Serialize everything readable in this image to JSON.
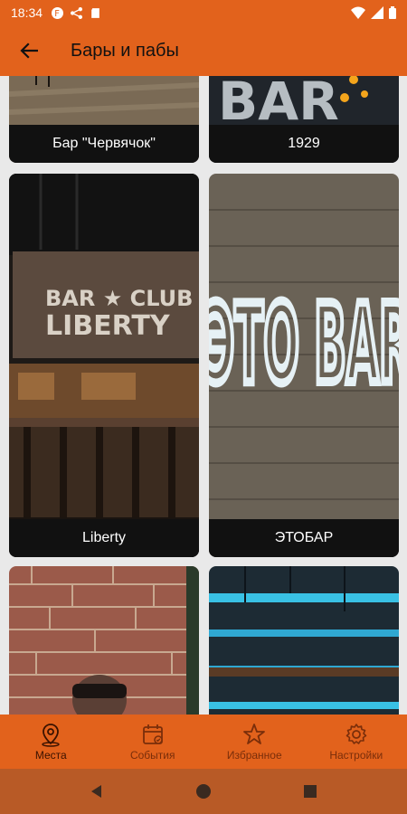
{
  "status_bar": {
    "time": "18:34"
  },
  "app_bar": {
    "title": "Бары и пабы"
  },
  "cards": [
    {
      "label": "Бар \"Червячок\""
    },
    {
      "label": "1929"
    },
    {
      "label": "Liberty",
      "sign_line1": "BAR ★ CLUB",
      "sign_line2": "LIBERTY"
    },
    {
      "label": "ЭТОБАР",
      "sign_text": "ЭТО BAR"
    },
    {
      "label": ""
    },
    {
      "label": ""
    }
  ],
  "bottom_nav": [
    {
      "label": "Места",
      "icon": "map-pin-icon"
    },
    {
      "label": "События",
      "icon": "calendar-icon"
    },
    {
      "label": "Избранное",
      "icon": "star-icon"
    },
    {
      "label": "Настройки",
      "icon": "gear-icon"
    }
  ],
  "colors": {
    "accent": "#e2621c",
    "nav_bar": "#b85a26"
  }
}
